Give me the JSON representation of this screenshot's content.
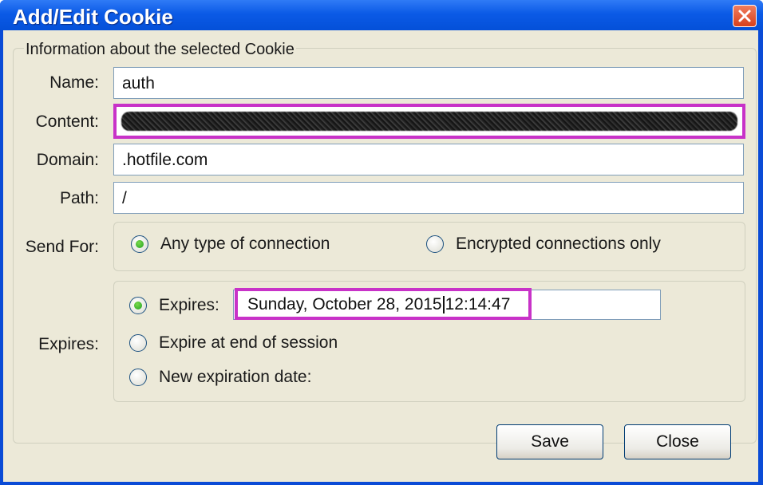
{
  "window": {
    "title": "Add/Edit Cookie"
  },
  "group": {
    "legend": "Information about the selected Cookie"
  },
  "fields": {
    "name_label": "Name:",
    "name_value": "auth",
    "content_label": "Content:",
    "content_value": "",
    "domain_label": "Domain:",
    "domain_value": ".hotfile.com",
    "path_label": "Path:",
    "path_value": "/"
  },
  "send_for": {
    "label": "Send For:",
    "options": [
      {
        "label": "Any type of connection",
        "checked": true
      },
      {
        "label": "Encrypted connections only",
        "checked": false
      }
    ]
  },
  "expires": {
    "label": "Expires:",
    "options": [
      {
        "label": "Expires:",
        "checked": true
      },
      {
        "label": "Expire at end of session",
        "checked": false
      },
      {
        "label": "New expiration date:",
        "checked": false
      }
    ],
    "date_part": "Sunday, October 28, 2015",
    "time_part": "12:14:47"
  },
  "buttons": {
    "save": "Save",
    "close": "Close"
  },
  "colors": {
    "title_bar": "#0b5ae6",
    "highlight": "#c832c8",
    "dialog_bg": "#ece9d8"
  },
  "icons": {
    "close": "close-x-icon"
  }
}
